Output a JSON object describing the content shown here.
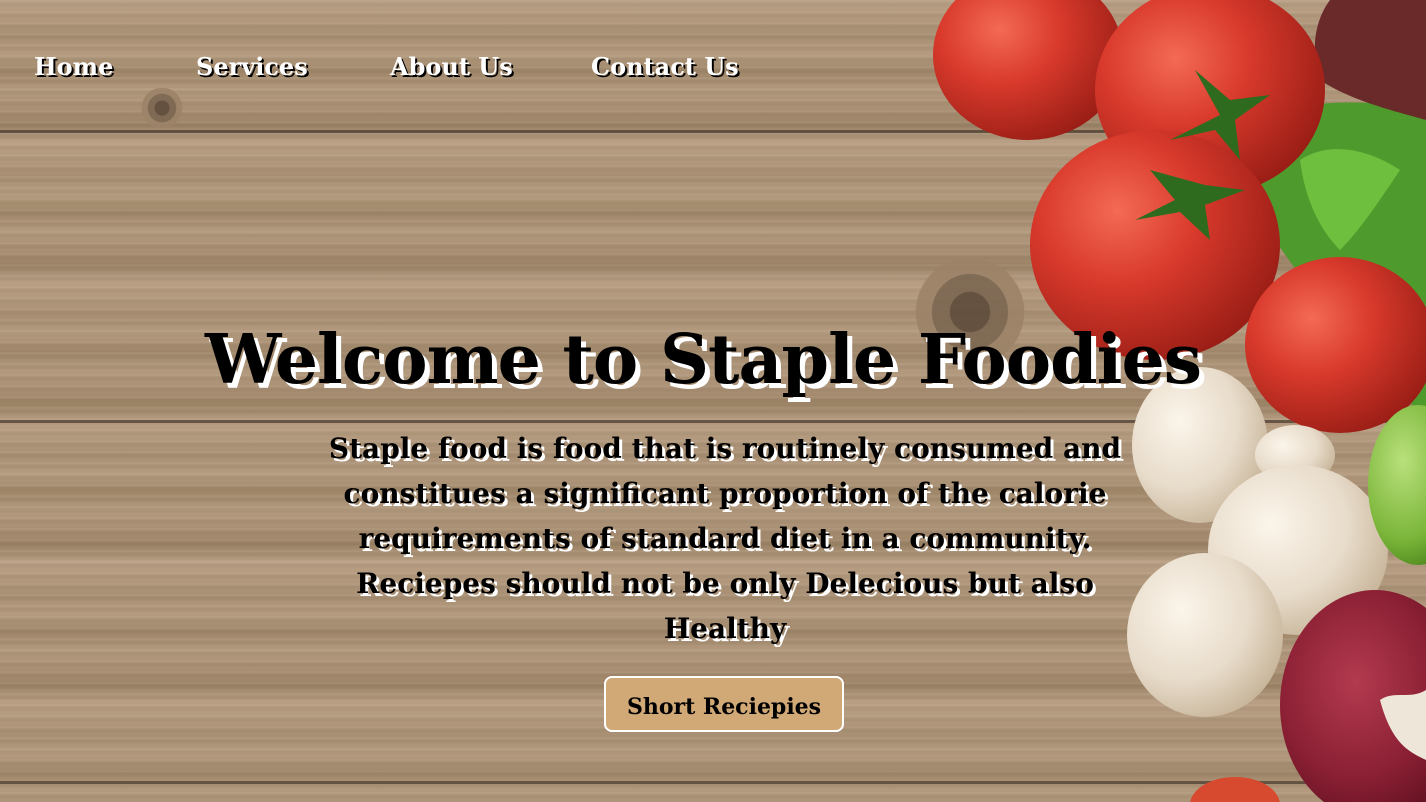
{
  "nav": {
    "items": [
      {
        "label": "Home"
      },
      {
        "label": "Services"
      },
      {
        "label": "About Us"
      },
      {
        "label": "Contact Us"
      }
    ]
  },
  "hero": {
    "title": "Welcome to Staple Foodies",
    "description": "Staple food is food that is routinely consumed and constitues a significant proportion of the calorie requirements of standard diet in a community. Reciepes should not be only Delecious but also Healthy",
    "cta_label": "Short Reciepies"
  },
  "colors": {
    "cta_background": "#d1a976",
    "nav_text": "#ffffff",
    "heading_text": "#000000"
  },
  "background": {
    "icons": [
      "wood-texture",
      "tomato-icon",
      "lettuce-icon",
      "mushroom-icon",
      "onion-icon",
      "apple-icon"
    ]
  }
}
